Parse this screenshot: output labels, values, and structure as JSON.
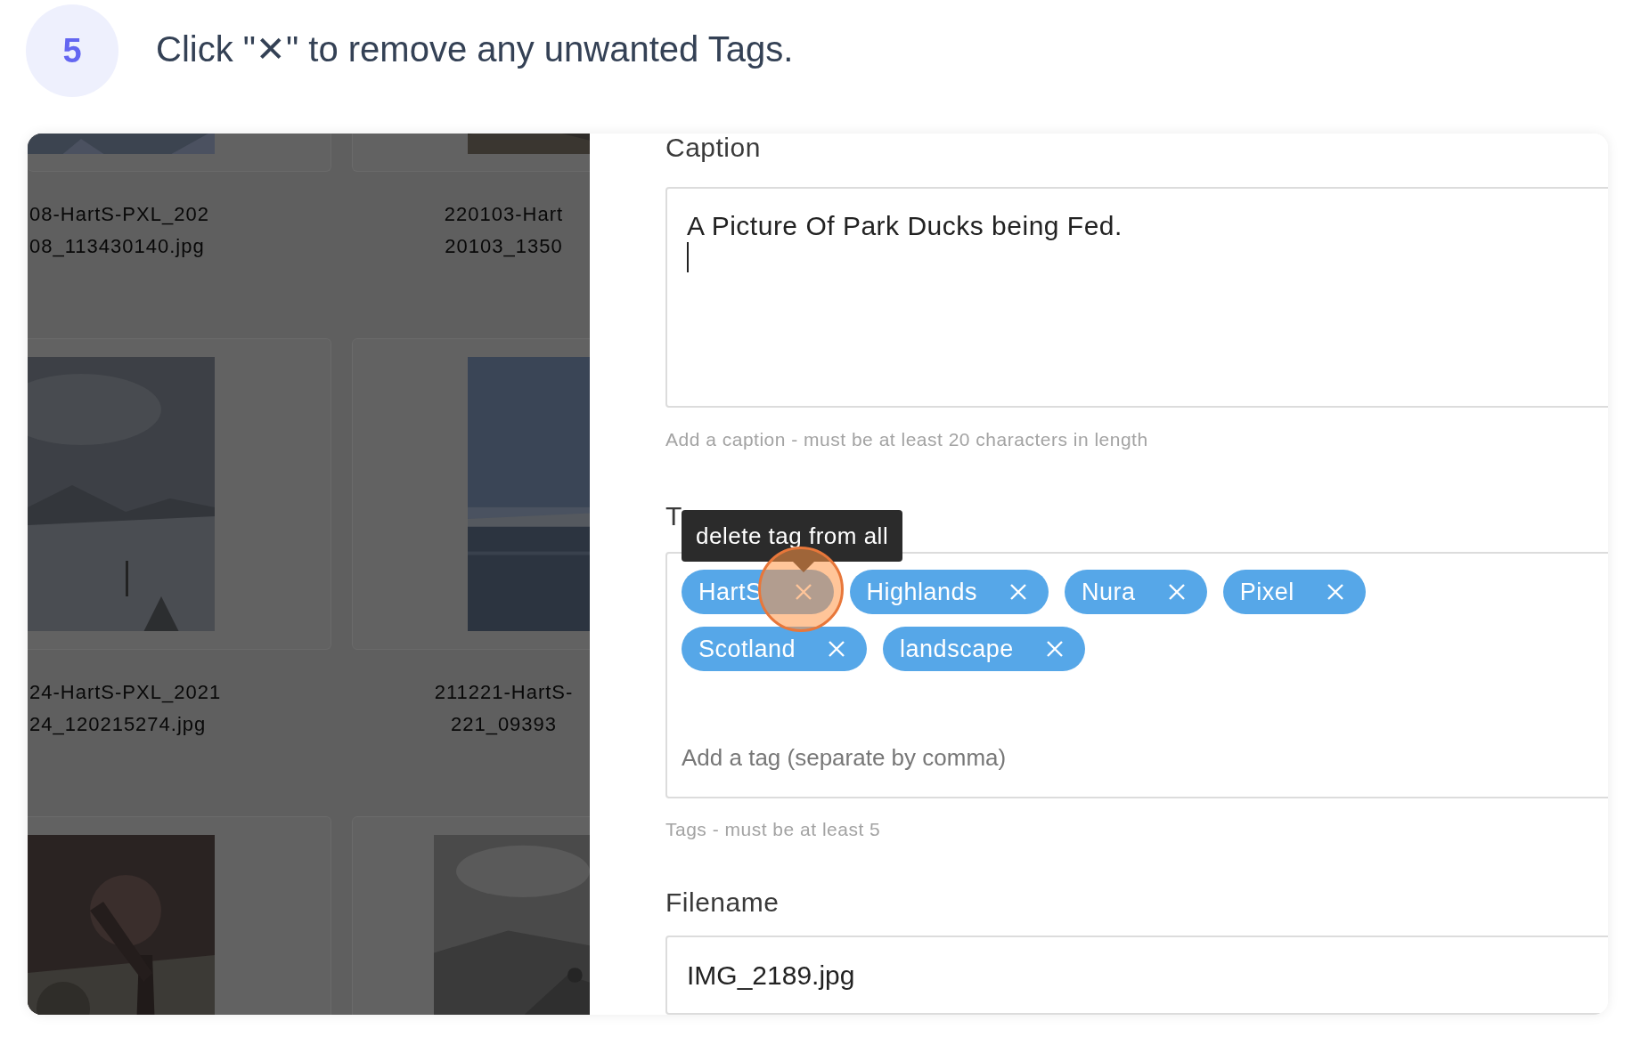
{
  "step": {
    "number": "5",
    "instruction": "Click \"✕\" to remove any unwanted Tags."
  },
  "gallery": {
    "items": [
      {
        "kind": "picture",
        "caption_lines": [
          "08-HartS-PXL_202",
          "08_113430140.jpg"
        ]
      },
      {
        "kind": "picture",
        "caption_lines": [
          "220103-Hart",
          "20103_1350"
        ]
      },
      {
        "kind": "picture",
        "caption_lines": [
          "24-HartS-PXL_2021",
          "24_120215274.jpg"
        ]
      },
      {
        "kind": "picture",
        "caption_lines": [
          "211221-HartS-",
          "221_09393"
        ]
      },
      {
        "kind": "picture"
      },
      {
        "kind": "picture"
      }
    ]
  },
  "form": {
    "caption": {
      "label": "Caption",
      "value": "A Picture Of Park Ducks being Fed.",
      "focused": true,
      "hint": "Add a caption - must be at least 20 characters in length"
    },
    "tags": {
      "label": "T",
      "items": [
        {
          "label": "HartS",
          "highlighted": true,
          "tooltip": "delete tag from all"
        },
        {
          "label": "Highlands",
          "highlighted": false
        },
        {
          "label": "Nura",
          "highlighted": false
        },
        {
          "label": "Pixel",
          "highlighted": false
        },
        {
          "label": "Scotland",
          "highlighted": false
        },
        {
          "label": "landscape",
          "highlighted": false
        }
      ],
      "placeholder": "Add a tag (separate by comma)",
      "hint": "Tags - must be at least 5"
    },
    "filename": {
      "label": "Filename",
      "value": "IMG_2189.jpg"
    }
  }
}
